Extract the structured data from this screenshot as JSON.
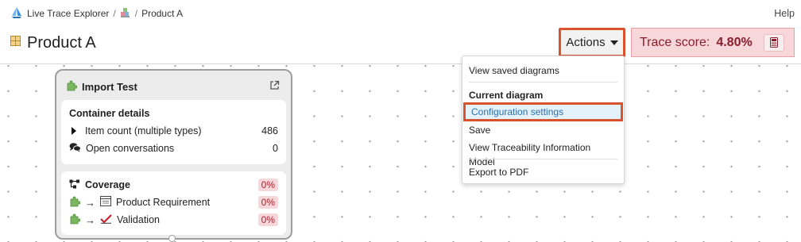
{
  "breadcrumb": {
    "app": "Live Trace Explorer",
    "separator": "/",
    "current": "Product A"
  },
  "help_label": "Help",
  "page_title": "Product A",
  "actions_label": "Actions",
  "trace_score": {
    "label": "Trace score:",
    "value": "4.80%"
  },
  "menu": {
    "items": {
      "view_saved": "View saved diagrams",
      "current_header": "Current diagram",
      "configuration": "Configuration settings",
      "save": "Save",
      "view_tim": "View Traceability Information Model",
      "export_pdf": "Export to PDF"
    }
  },
  "node": {
    "title": "Import Test",
    "container": {
      "heading": "Container details",
      "item_count_label": "Item count (multiple types)",
      "item_count_value": "486",
      "open_conv_label": "Open conversations",
      "open_conv_value": "0"
    },
    "coverage": {
      "heading": "Coverage",
      "heading_pct": "0%",
      "rows": [
        {
          "label": "Product Requirement",
          "pct": "0%"
        },
        {
          "label": "Validation",
          "pct": "0%"
        }
      ]
    }
  },
  "colors": {
    "highlight_border": "#d9542c",
    "score_bg": "#f8d7da",
    "score_text": "#8b1c2b",
    "menu_active_bg": "#e3f2fb",
    "menu_active_text": "#2a6fb0"
  },
  "icons": [
    "logo-icon",
    "folder-icon",
    "product-icon",
    "caret-down-icon",
    "calculator-icon",
    "puzzle-icon",
    "external-link-icon",
    "chevron-right-icon",
    "conversation-icon",
    "coverage-icon",
    "arrow-right-icon",
    "document-icon",
    "check-icon"
  ]
}
